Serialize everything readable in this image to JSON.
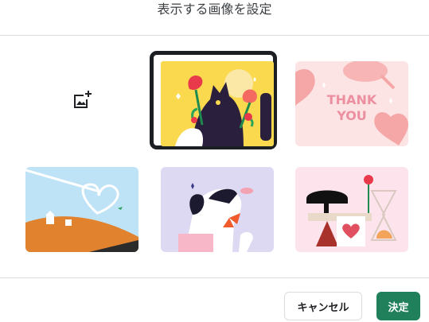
{
  "dialog": {
    "title": "表示する画像を設定"
  },
  "tiles": [
    {
      "name": "upload",
      "icon": "add-photo-icon"
    },
    {
      "name": "cat-flowers",
      "selected": true
    },
    {
      "name": "thank-you",
      "text_line1": "THANK",
      "text_line2": "YOU"
    },
    {
      "name": "heart-sky"
    },
    {
      "name": "dog-bow"
    },
    {
      "name": "hourglass-rose"
    }
  ],
  "footer": {
    "cancel_label": "キャンセル",
    "ok_label": "決定"
  },
  "colors": {
    "accent": "#20805c",
    "selection_ring": "#1b1f23"
  }
}
